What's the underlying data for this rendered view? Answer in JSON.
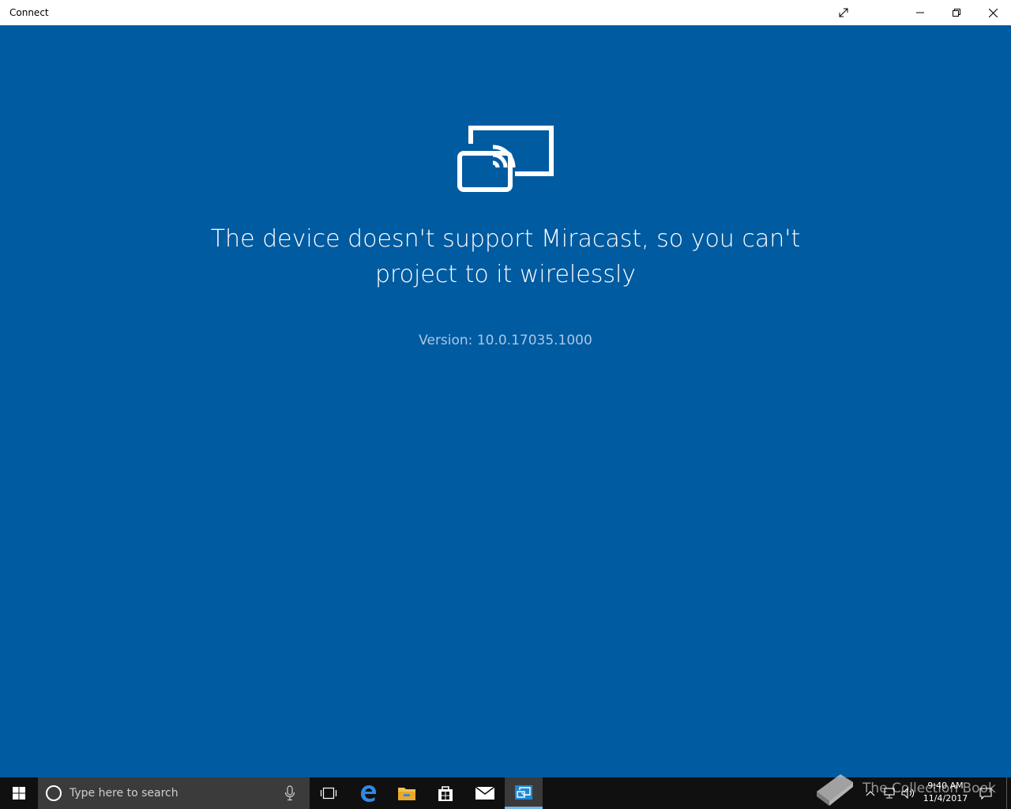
{
  "window": {
    "title": "Connect"
  },
  "main": {
    "message": "The device doesn't support Miracast, so you can't project to it wirelessly",
    "version": "Version: 10.0.17035.1000",
    "icon": "project-cast-icon"
  },
  "taskbar": {
    "search_placeholder": "Type here to search",
    "apps": [
      "task-view-icon",
      "edge-icon",
      "file-explorer-icon",
      "store-icon",
      "mail-icon",
      "connect-icon"
    ],
    "time": "9:40 AM",
    "date": "11/4/2017",
    "watermark": "The Collection Book"
  },
  "colors": {
    "background": "#005ba1",
    "taskbar": "#101010",
    "search_box": "#3b3b3b",
    "accent": "#76b9ed"
  }
}
